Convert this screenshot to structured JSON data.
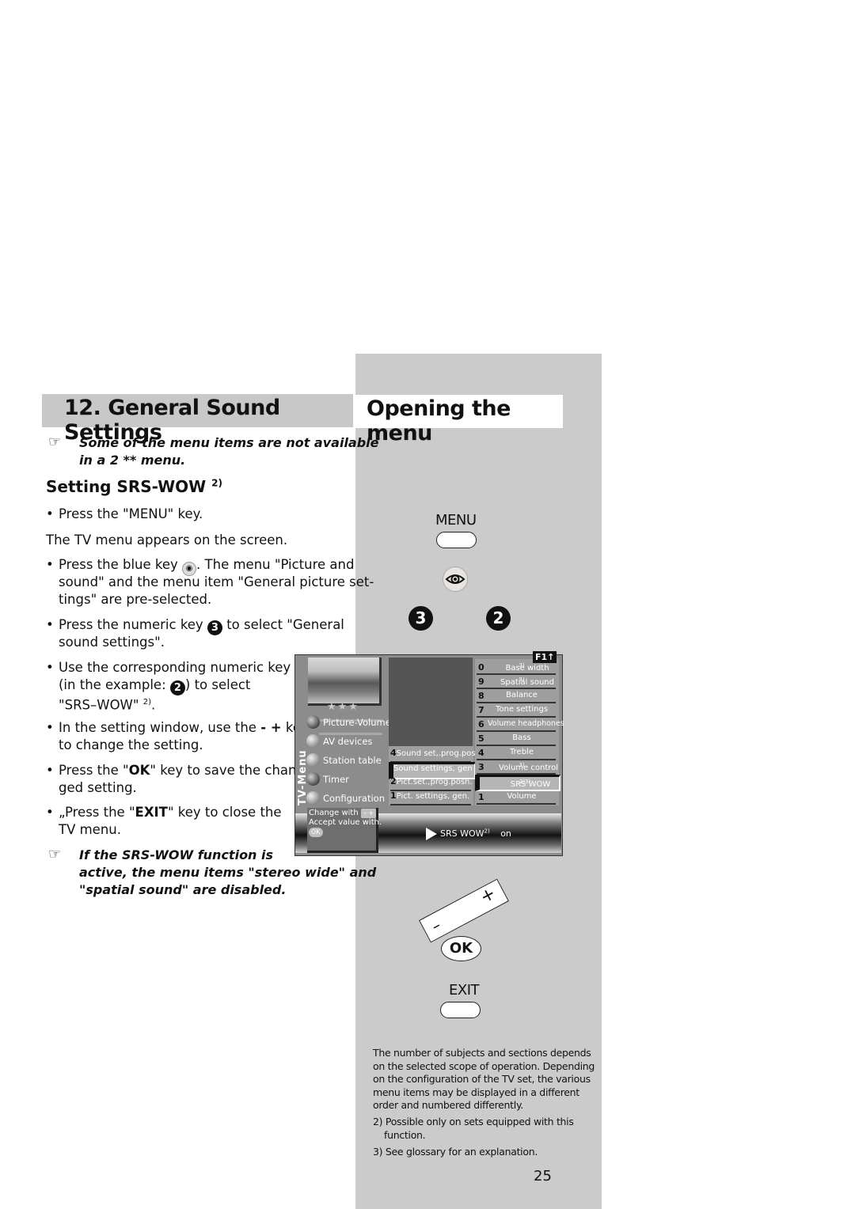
{
  "left": {
    "section_title": "12. General Sound Settings",
    "note_top": "Some of the menu items are not available in a 2 ** menu.",
    "note_top_line1": "Some of the menu items are not available",
    "note_top_line2": "in a 2 ** menu.",
    "subheading": "Setting SRS-WOW",
    "subheading_sup": "2)",
    "steps": [
      {
        "lines": [
          "Press the \"MENU\" key."
        ]
      },
      {
        "plain": "The TV menu appears on the screen."
      },
      {
        "lines": [
          "Press the blue key",
          ". The menu \"Picture and",
          "sound\" and the menu item \"General picture set-",
          "tings\" are pre-selected."
        ]
      },
      {
        "lines": [
          "Press the numeric key",
          "to select \"General",
          "sound settings\"."
        ],
        "key": "3"
      },
      {
        "lines": [
          "Use the corresponding numeric key",
          "(in the example:",
          ") to select",
          "\"SRS–WOW\"",
          "2)",
          "."
        ],
        "key": "2"
      },
      {
        "lines": [
          "In the setting window, use the",
          "- +",
          "key",
          "to change the setting."
        ]
      },
      {
        "lines": [
          "Press the \"",
          "OK",
          "\" key to save the chan-",
          "ged setting."
        ]
      },
      {
        "lines": [
          "„Press the \"",
          "EXIT",
          "\" key to close the",
          "TV menu."
        ]
      }
    ],
    "note_bottom_line1": "If the SRS-WOW function is",
    "note_bottom_line2": "active, the menu items \"stereo wide\" and",
    "note_bottom_line3": "\"spatial sound\" are disabled."
  },
  "right": {
    "section_title": "Opening the menu",
    "menu_key_label": "MENU",
    "eye_key": "eye-icon",
    "num_key_a": "3",
    "num_key_b": "2",
    "plus": "+",
    "minus": "–",
    "ok_label": "OK",
    "exit_label": "EXIT",
    "footnote_main_lines": [
      "The number of subjects and sections depends",
      "on the selected scope of operation. Depending",
      "on the configuration of the TV set, the various",
      "menu items may be displayed in a different",
      "order and numbered differently."
    ],
    "footnote_2_line1": "2) Possible only on sets equipped with this",
    "footnote_2_line2": "function.",
    "footnote_3": "3) See glossary for an explanation.",
    "page_number": "25"
  },
  "tv_menu": {
    "stars": "★★★",
    "vertical_title": "TV-Menu",
    "nav": [
      "Picture-Volume",
      "AV devices",
      "Station table",
      "Timer",
      "Configuration"
    ],
    "help_line1": "Change with",
    "help_keys": "– +",
    "help_line2": "Accept value with.",
    "help_ok": "OK",
    "middle": [
      {
        "num": "4",
        "label": "Sound set,.prog.pos"
      },
      {
        "num": "3",
        "label": "Sound settings, gen",
        "selected": true
      },
      {
        "num": "2",
        "label": "Pict.set.,prog.posn."
      },
      {
        "num": "1",
        "label": "Pict. settings, gen."
      }
    ],
    "f1": "F1↑",
    "right": [
      {
        "num": "0",
        "label": "Base width",
        "sup": "3)"
      },
      {
        "num": "9",
        "label": "Spatial sound",
        "sup": "3)"
      },
      {
        "num": "8",
        "label": "Balance"
      },
      {
        "num": "7",
        "label": "Tone settings"
      },
      {
        "num": "6",
        "label": "Volume headphones"
      },
      {
        "num": "5",
        "label": "Bass"
      },
      {
        "num": "4",
        "label": "Treble"
      },
      {
        "num": "3",
        "label": "Volume control",
        "sup": "3)"
      },
      {
        "num": "2",
        "label": "SRS WOW",
        "sup": "2)3)",
        "selected": true
      },
      {
        "num": "1",
        "label": "Volume"
      }
    ],
    "status_label": "SRS WOW",
    "status_sup": "2)",
    "status_value": "on"
  }
}
